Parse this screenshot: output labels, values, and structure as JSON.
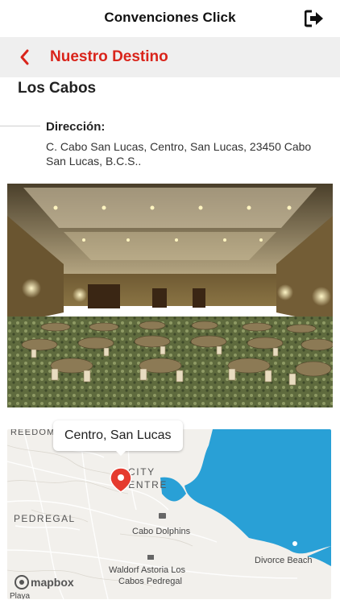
{
  "header": {
    "app_title": "Convenciones Click",
    "logout_icon": "sign-out-icon"
  },
  "nav": {
    "title": "Nuestro Destino",
    "back_icon": "chevron-left-icon",
    "accent": "#d9241b"
  },
  "destination": {
    "name": "Los Cabos",
    "address_label": "Dirección:",
    "address": "C. Cabo San Lucas, Centro, San Lucas, 23450 Cabo San Lucas, B.C.S.."
  },
  "map": {
    "callout": "Centro, San Lucas",
    "labels": {
      "freedom": "REEDOM",
      "city_centre": "CITY\nCENTRE",
      "pedregal": "PEDREGAL",
      "cabo_dolphins": "Cabo Dolphins",
      "divorce_beach": "Divorce Beach",
      "waldorf": "Waldorf Astoria Los\nCabos Pedregal",
      "playa": "Playa"
    },
    "attribution": "mapbox",
    "water_color": "#29a0d6",
    "land_color": "#f2f0ec"
  }
}
